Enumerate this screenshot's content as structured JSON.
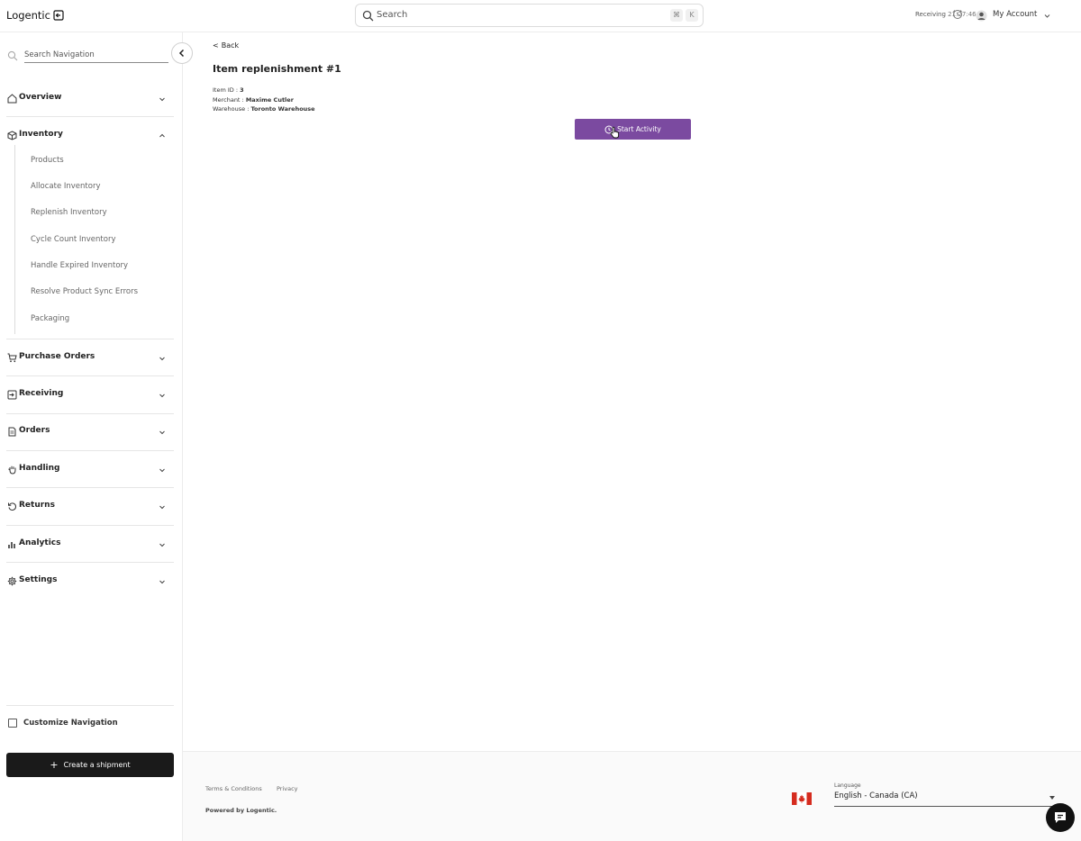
{
  "app": {
    "logo": "Logentic"
  },
  "search": {
    "placeholder": "Search",
    "kbd_cmd": "⌘",
    "kbd_k": "K"
  },
  "header": {
    "receiving_label": "Receiving",
    "receiving_time": "21:27:46",
    "account_label": "My Account"
  },
  "sidebar": {
    "search_placeholder": "Search Navigation",
    "sections": {
      "overview": "Overview",
      "inventory": "Inventory",
      "purchase_orders": "Purchase Orders",
      "receiving": "Receiving",
      "orders": "Orders",
      "handling": "Handling",
      "returns": "Returns",
      "analytics": "Analytics",
      "settings": "Settings"
    },
    "inventory_items": [
      "Products",
      "Allocate Inventory",
      "Replenish Inventory",
      "Cycle Count Inventory",
      "Handle Expired Inventory",
      "Resolve Product Sync Errors",
      "Packaging"
    ],
    "customize_label": "Customize Navigation",
    "create_shipment_label": "Create a shipment"
  },
  "main": {
    "back_label": "Back",
    "title": "Item replenishment #1",
    "item_id_label": "Item ID :",
    "item_id_value": "3",
    "merchant_label": "Merchant :",
    "merchant_value": "Maxime Cutler",
    "warehouse_label": "Warehouse :",
    "warehouse_value": "Toronto Warehouse",
    "start_label": "Start Activity"
  },
  "footer": {
    "terms": "Terms & Conditions",
    "privacy": "Privacy",
    "powered": "Powered by Logentic.",
    "language_label": "Language",
    "language_value": "English - Canada (CA)"
  },
  "colors": {
    "accent": "#7b4aa0",
    "dark_button": "#1a1a1a"
  }
}
